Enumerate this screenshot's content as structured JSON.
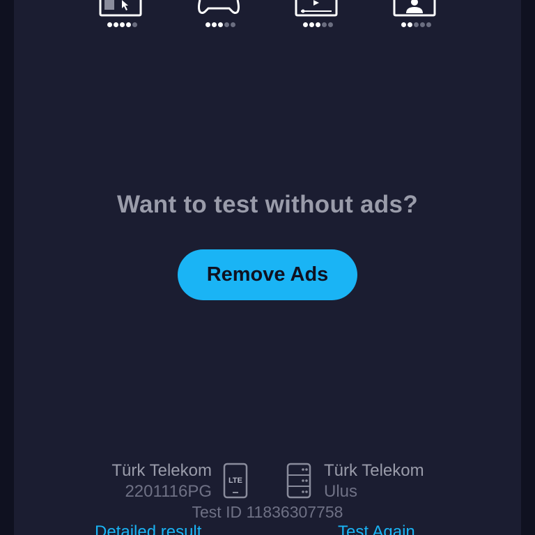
{
  "colors": {
    "background": "#1b1d31",
    "accent": "#1ab4f5",
    "text_muted": "#9a9caa",
    "dot_on": "#ffffff",
    "dot_off": "#6b6e80"
  },
  "ratings": [
    {
      "icon": "browsing-icon",
      "level": 4,
      "max": 5
    },
    {
      "icon": "gamepad-icon",
      "level": 3,
      "max": 5
    },
    {
      "icon": "video-icon",
      "level": 3,
      "max": 5
    },
    {
      "icon": "video-call-icon",
      "level": 2,
      "max": 5
    }
  ],
  "upsell": {
    "title": "Want to test without ads?",
    "button_label": "Remove Ads"
  },
  "connection": {
    "client_provider": "Türk Telekom",
    "client_device": "2201116PG",
    "network_type": "LTE",
    "server_provider": "Türk Telekom",
    "server_location": "Ulus"
  },
  "test_id": "Test ID 11836307758",
  "links": {
    "detailed": "Detailed result",
    "again": "Test Again"
  }
}
